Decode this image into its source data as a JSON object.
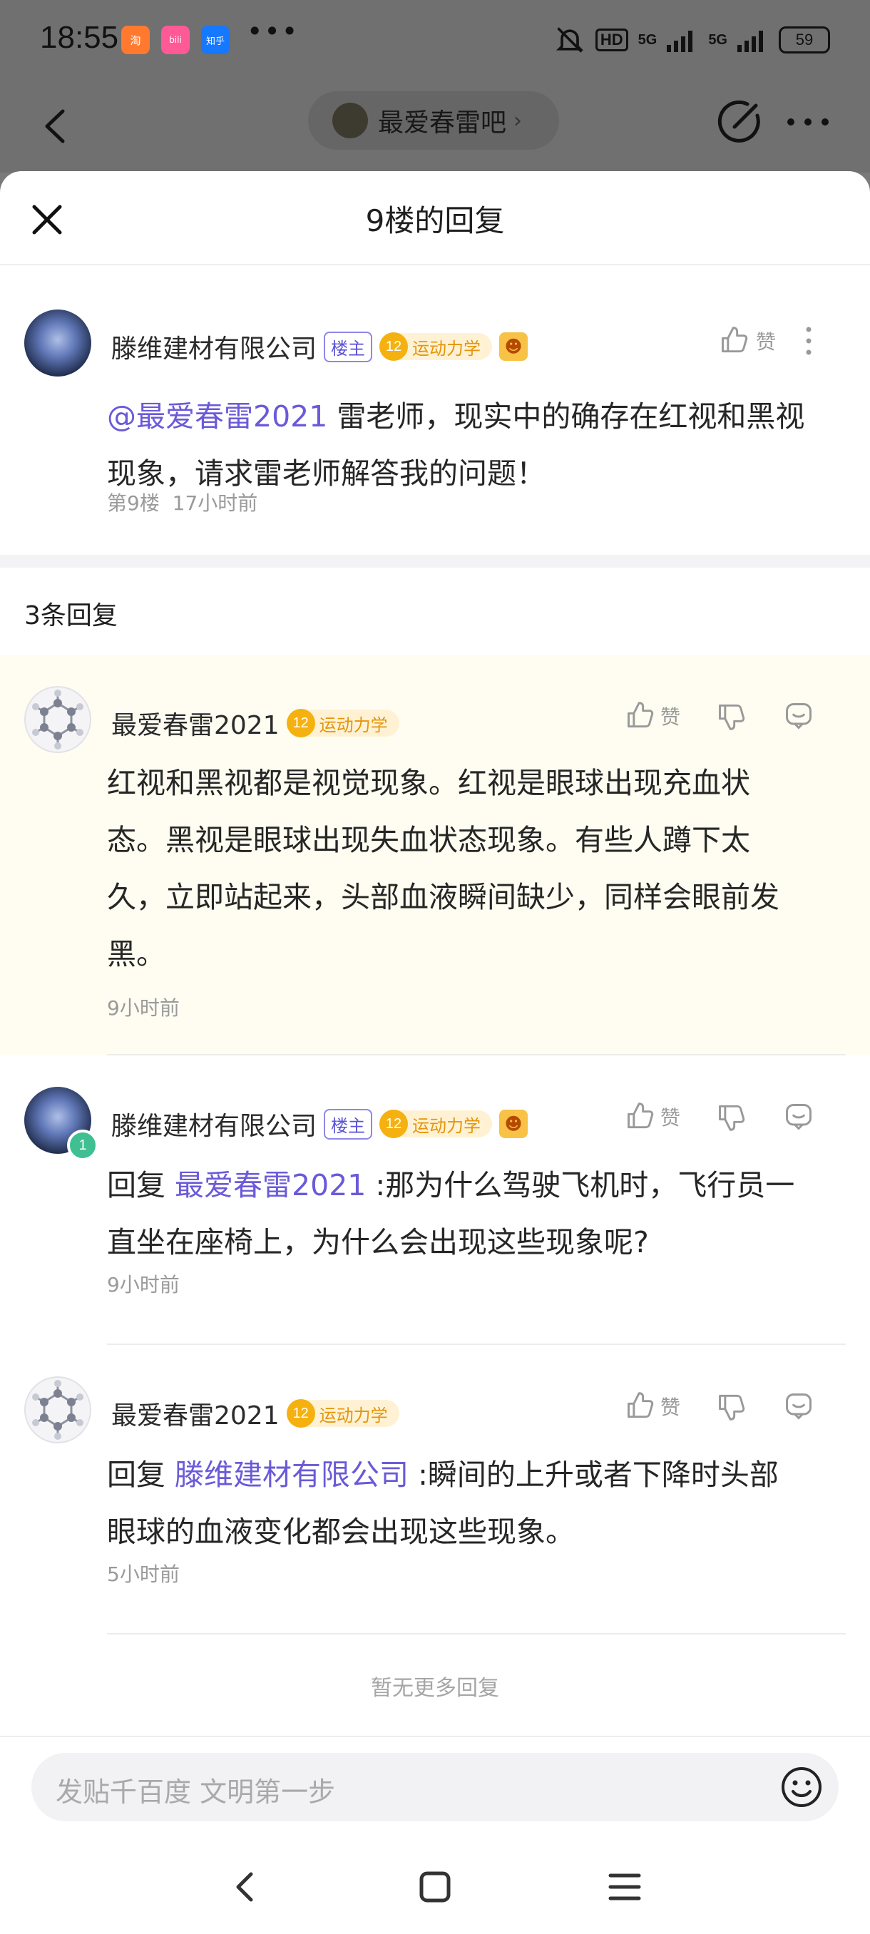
{
  "status": {
    "time": "18:55",
    "apps": [
      "淘",
      "bili",
      "知乎"
    ],
    "more": "•••",
    "hd": "HD",
    "net1": "5G",
    "net2": "5G",
    "battery": "59"
  },
  "nav": {
    "forum": "最爱春雷吧",
    "chevron": "›"
  },
  "sheet": {
    "title": "9楼的回复"
  },
  "main_post": {
    "author": "滕维建材有限公司",
    "owner_tag": "楼主",
    "level": "12",
    "level_name": "运动力学",
    "like": "赞",
    "mention": "@最爱春雷2021",
    "text_line1": " 雷老师，现实中的确存在红视和黑视",
    "text_line2": "现象，请求雷老师解答我的问题！",
    "floor": "第9楼",
    "time": "17小时前"
  },
  "reply_count": "3条回复",
  "replies": [
    {
      "author": "最爱春雷2021",
      "level": "12",
      "level_name": "运动力学",
      "like": "赞",
      "lines": [
        "红视和黑视都是视觉现象。红视是眼球出现充血状",
        "态。黑视是眼球出现失血状态现象。有些人蹲下太",
        "久，立即站起来，头部血液瞬间缺少，同样会眼前发",
        "黑。"
      ],
      "time": "9小时前"
    },
    {
      "author": "滕维建材有限公司",
      "owner_tag": "楼主",
      "badge": "1",
      "level": "12",
      "level_name": "运动力学",
      "like": "赞",
      "reply_prefix": "回复 ",
      "reply_to": "最爱春雷2021",
      "line1": " :那为什么驾驶飞机时，飞行员一",
      "line2": "直坐在座椅上，为什么会出现这些现象呢?",
      "time": "9小时前"
    },
    {
      "author": "最爱春雷2021",
      "level": "12",
      "level_name": "运动力学",
      "like": "赞",
      "reply_prefix": "回复 ",
      "reply_to": "滕维建材有限公司",
      "line1": " :瞬间的上升或者下降时头部",
      "line2": "眼球的血液变化都会出现这些现象。",
      "time": "5小时前"
    }
  ],
  "no_more": "暂无更多回复",
  "input": {
    "placeholder": "发贴千百度 文明第一步"
  },
  "colors": {
    "accent": "#6a5ad9",
    "highlight": "#fffdf1",
    "level_gold": "#f5b10f"
  }
}
